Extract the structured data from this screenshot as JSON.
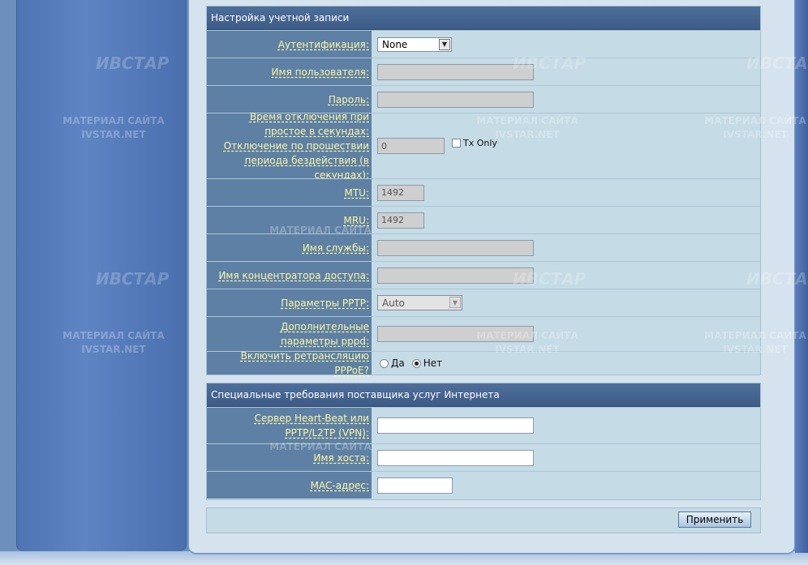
{
  "account_section": {
    "title": "Настройка учетной записи",
    "auth_label": "Аутентификация:",
    "auth_value": "None",
    "username_label": "Имя пользователя:",
    "password_label": "Пароль:",
    "idle_label": "Время отключения при простое в секундах: Отключение по прошествии периода бездействия (в секундах):",
    "idle_value": "0",
    "tx_only_label": "Tx Only",
    "mtu_label": "MTU:",
    "mtu_value": "1492",
    "mru_label": "MRU:",
    "mru_value": "1492",
    "service_label": "Имя службы:",
    "concentrator_label": "Имя концентратора доступа:",
    "pptp_label": "Параметры PPTP:",
    "pptp_value": "Auto",
    "pppd_label": "Дополнительные параметры pppd:",
    "relay_label": "Включить ретрансляцию PPPoE?",
    "relay_yes": "Да",
    "relay_no": "Нет"
  },
  "isp_section": {
    "title": "Специальные требования поставщика услуг Интернета",
    "heartbeat_label": "Сервер Heart-Beat или PPTP/L2TP (VPN):",
    "hostname_label": "Имя хоста:",
    "mac_label": "MAC-адрес:"
  },
  "apply_button": "Применить",
  "watermark": {
    "logo": "ИВСТАР",
    "line1": "МАТЕРИАЛ САЙТА",
    "line2": "IVSTAR.NET"
  }
}
